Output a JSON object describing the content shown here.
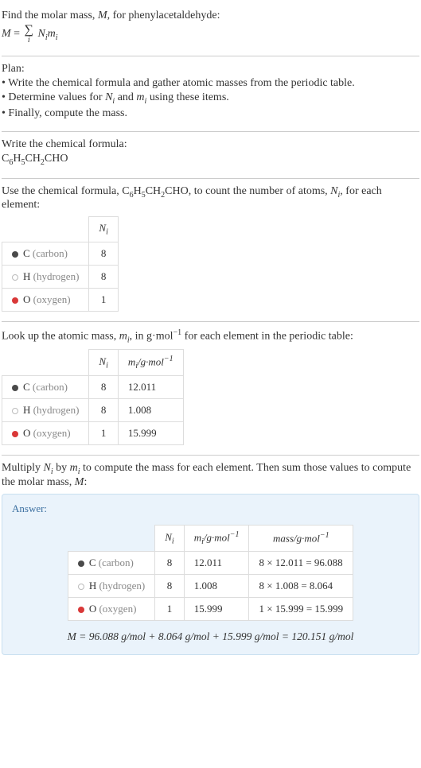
{
  "intro": {
    "line1": "Find the molar mass, M, for phenylacetaldehyde:",
    "formula": "M = Σ N_i m_i",
    "sigma_index": "i"
  },
  "plan": {
    "heading": "Plan:",
    "items": [
      "• Write the chemical formula and gather atomic masses from the periodic table.",
      "• Determine values for N_i and m_i using these items.",
      "• Finally, compute the mass."
    ]
  },
  "formula_section": {
    "heading": "Write the chemical formula:",
    "formula": "C6H5CH2CHO"
  },
  "count_section": {
    "text_a": "Use the chemical formula, ",
    "text_b": ", to count the number of atoms, N_i, for each element:",
    "header_n": "N_i",
    "rows": [
      {
        "dot": "c",
        "sym": "C",
        "name": "(carbon)",
        "n": "8"
      },
      {
        "dot": "h",
        "sym": "H",
        "name": "(hydrogen)",
        "n": "8"
      },
      {
        "dot": "o",
        "sym": "O",
        "name": "(oxygen)",
        "n": "1"
      }
    ]
  },
  "mass_section": {
    "text": "Look up the atomic mass, m_i, in g·mol⁻¹ for each element in the periodic table:",
    "header_n": "N_i",
    "header_m": "m_i/g·mol⁻¹",
    "rows": [
      {
        "dot": "c",
        "sym": "C",
        "name": "(carbon)",
        "n": "8",
        "m": "12.011"
      },
      {
        "dot": "h",
        "sym": "H",
        "name": "(hydrogen)",
        "n": "8",
        "m": "1.008"
      },
      {
        "dot": "o",
        "sym": "O",
        "name": "(oxygen)",
        "n": "1",
        "m": "15.999"
      }
    ]
  },
  "result_section": {
    "text": "Multiply N_i by m_i to compute the mass for each element. Then sum those values to compute the molar mass, M:",
    "answer_label": "Answer:",
    "header_n": "N_i",
    "header_m": "m_i/g·mol⁻¹",
    "header_mass": "mass/g·mol⁻¹",
    "rows": [
      {
        "dot": "c",
        "sym": "C",
        "name": "(carbon)",
        "n": "8",
        "m": "12.011",
        "calc": "8 × 12.011 = 96.088"
      },
      {
        "dot": "h",
        "sym": "H",
        "name": "(hydrogen)",
        "n": "8",
        "m": "1.008",
        "calc": "8 × 1.008 = 8.064"
      },
      {
        "dot": "o",
        "sym": "O",
        "name": "(oxygen)",
        "n": "1",
        "m": "15.999",
        "calc": "1 × 15.999 = 15.999"
      }
    ],
    "final": "M = 96.088 g/mol + 8.064 g/mol + 15.999 g/mol = 120.151 g/mol"
  }
}
